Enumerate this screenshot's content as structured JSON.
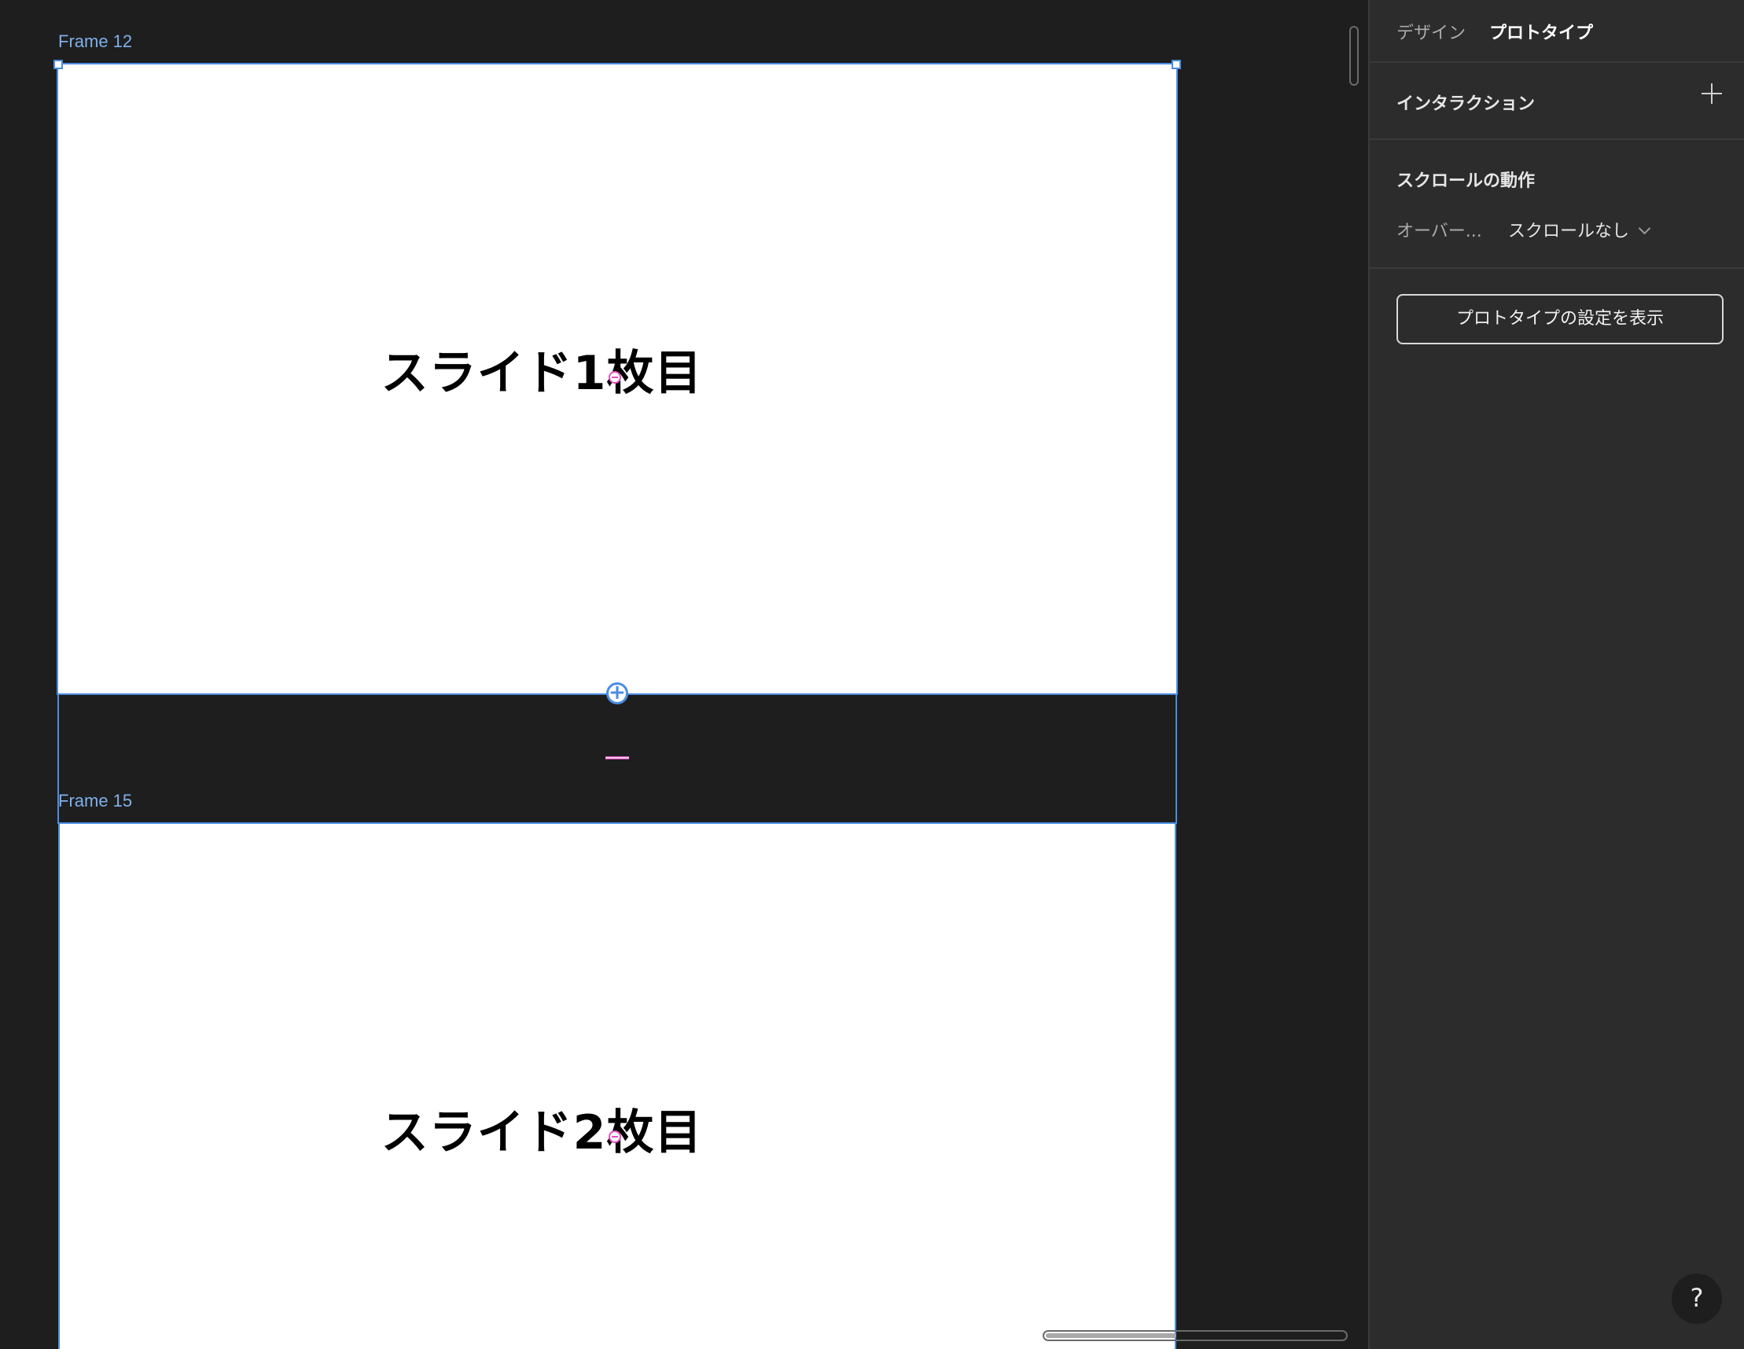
{
  "canvas": {
    "frames": [
      {
        "label": "Frame 12",
        "text": "スライド1枚目"
      },
      {
        "label": "Frame 15",
        "text": "スライド2枚目"
      }
    ],
    "add_icon": "+",
    "accent_color": "#4a8de0",
    "guide_color": "#e04fc0"
  },
  "panel": {
    "tabs": [
      {
        "label": "デザイン",
        "active": false
      },
      {
        "label": "プロトタイプ",
        "active": true
      }
    ],
    "interactions": {
      "title": "インタラクション",
      "add_icon": "plus-icon"
    },
    "scroll": {
      "title": "スクロールの動作",
      "overflow_label": "オーバー...",
      "overflow_value": "スクロールなし"
    },
    "settings_button": "プロトタイプの設定を表示"
  },
  "help": {
    "label": "?"
  }
}
